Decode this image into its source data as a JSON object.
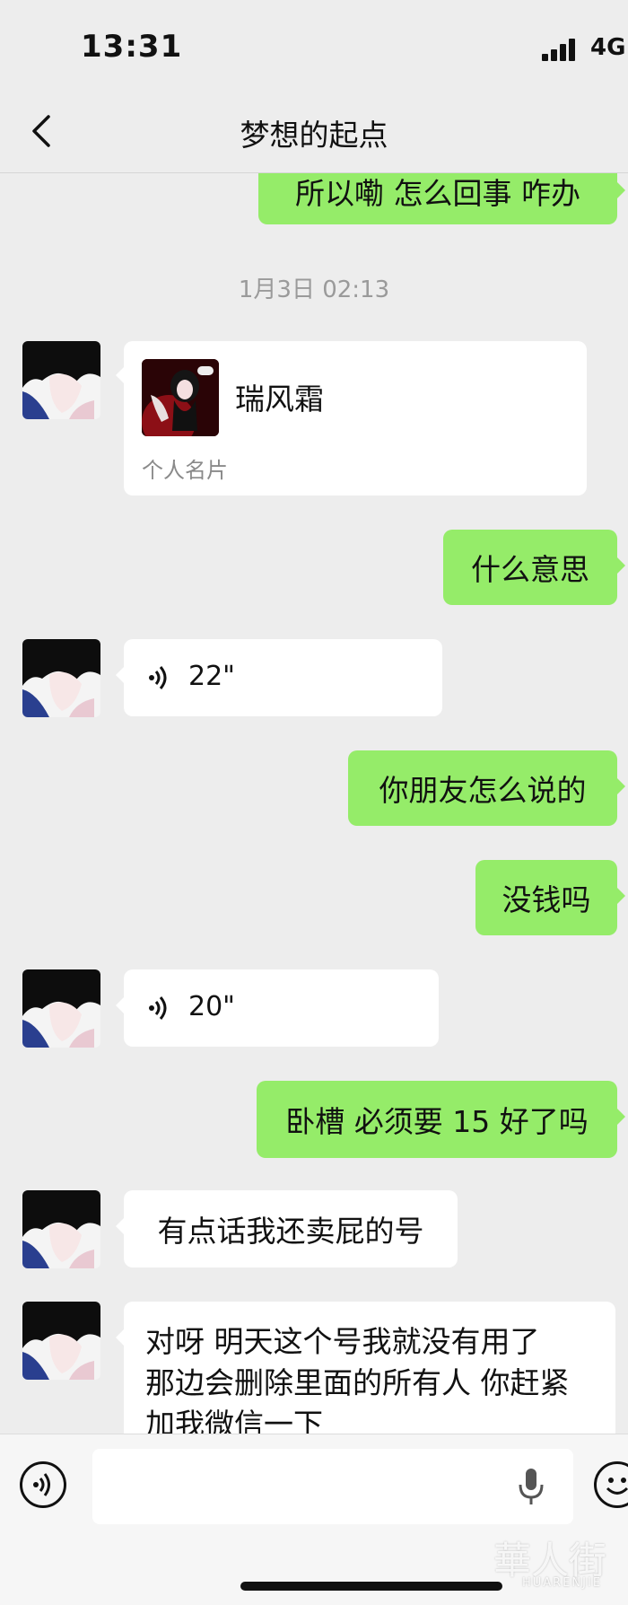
{
  "status_bar": {
    "time": "13:31",
    "network": "4G"
  },
  "header": {
    "title": "梦想的起点"
  },
  "timestamp": "1月3日 02:13",
  "messages": [
    {
      "side": "sent",
      "type": "text",
      "text": "所以嘞  怎么回事 咋办"
    },
    {
      "side": "recv",
      "type": "card",
      "name": "瑞风霜",
      "card_type": "个人名片"
    },
    {
      "side": "sent",
      "type": "text",
      "text": "什么意思"
    },
    {
      "side": "recv",
      "type": "voice",
      "duration": "22\""
    },
    {
      "side": "sent",
      "type": "text",
      "text": "你朋友怎么说的"
    },
    {
      "side": "sent",
      "type": "text",
      "text": "没钱吗"
    },
    {
      "side": "recv",
      "type": "voice",
      "duration": "20\""
    },
    {
      "side": "sent",
      "type": "text",
      "text": "卧槽  必须要 15 好了吗"
    },
    {
      "side": "recv",
      "type": "text",
      "text": "有点话我还卖屁的号"
    },
    {
      "side": "recv",
      "type": "text",
      "text": "对呀 明天这个号我就没有用了 那边会删除里面的所有人 你赶紧加我微信一下"
    }
  ],
  "watermark": {
    "cn": "華人街",
    "en": "HUARENJIE"
  },
  "colors": {
    "sent_bubble": "#95ec69",
    "recv_bubble": "#ffffff",
    "background": "#ededed"
  },
  "icons": [
    "back-arrow-icon",
    "voice-wave-icon",
    "microphone-icon",
    "emoji-icon",
    "signal-icon"
  ]
}
